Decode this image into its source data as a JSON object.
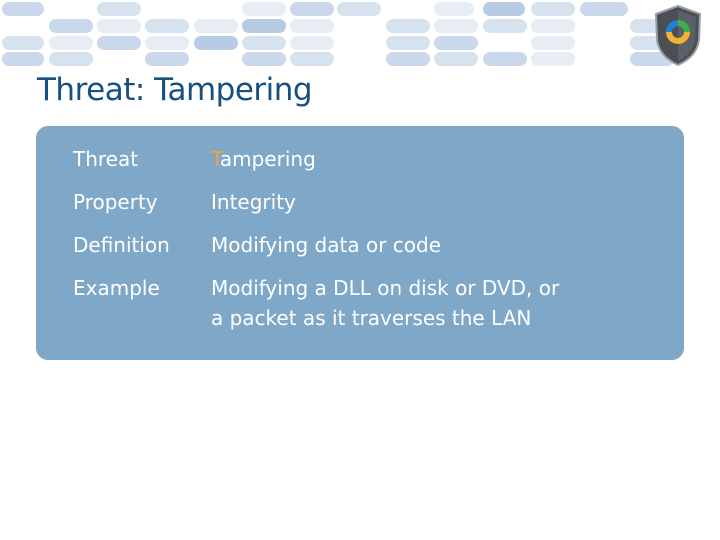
{
  "slide": {
    "title": "Threat: Tampering",
    "accent_color": "#f3a13a",
    "title_color": "#17507e",
    "card_color": "#7fa7c8"
  },
  "logo": {
    "icon": "shield-cycle-icon"
  },
  "table": {
    "rows": [
      {
        "label": "Threat",
        "value_first_letter": "T",
        "value_rest": "ampering"
      },
      {
        "label": "Property",
        "value": "Integrity"
      },
      {
        "label": "Definition",
        "value": "Modifying data or code"
      },
      {
        "label": "Example",
        "value_line1": "Modifying a DLL on disk or DVD, or",
        "value_line2": "a packet as it traverses the LAN"
      }
    ]
  }
}
